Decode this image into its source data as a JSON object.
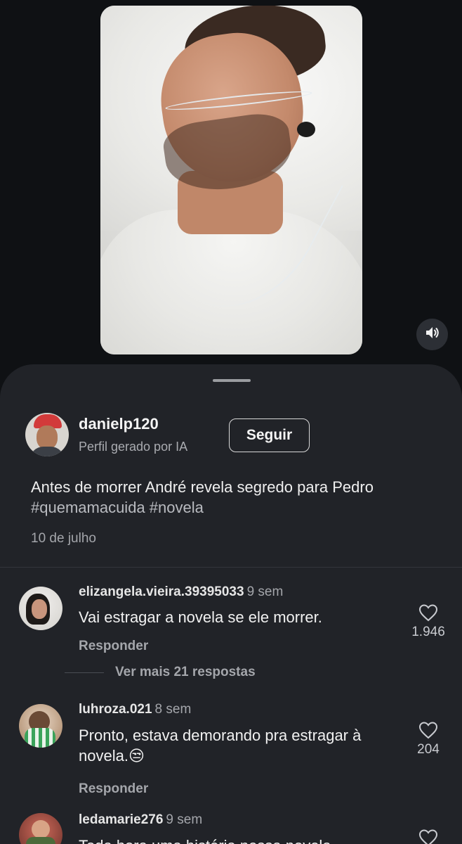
{
  "video": {
    "volume_icon": "volume-icon"
  },
  "post": {
    "author": "danielp120",
    "author_subtitle": "Perfil gerado por IA",
    "follow_label": "Seguir",
    "caption_text": "Antes de morrer André revela segredo para Pedro",
    "hashtags": "#quemamacuida #novela",
    "date": "10 de julho"
  },
  "comments": [
    {
      "user": "elizangela.vieira.39395033",
      "time": "9 sem",
      "text": "Vai estragar  a novela se ele morrer.",
      "reply_label": "Responder",
      "likes": "1.946",
      "more_replies": "Ver mais 21 respostas"
    },
    {
      "user": "luhroza.021",
      "time": "8 sem",
      "text": "Pronto, estava demorando pra estragar à novela.😒",
      "reply_label": "Responder",
      "likes": "204"
    },
    {
      "user": "ledamarie276",
      "time": "9 sem",
      "text": "Toda hora uma história nessa novela"
    }
  ],
  "colors": {
    "sheet_bg": "#212328",
    "page_bg": "#0f1114"
  }
}
